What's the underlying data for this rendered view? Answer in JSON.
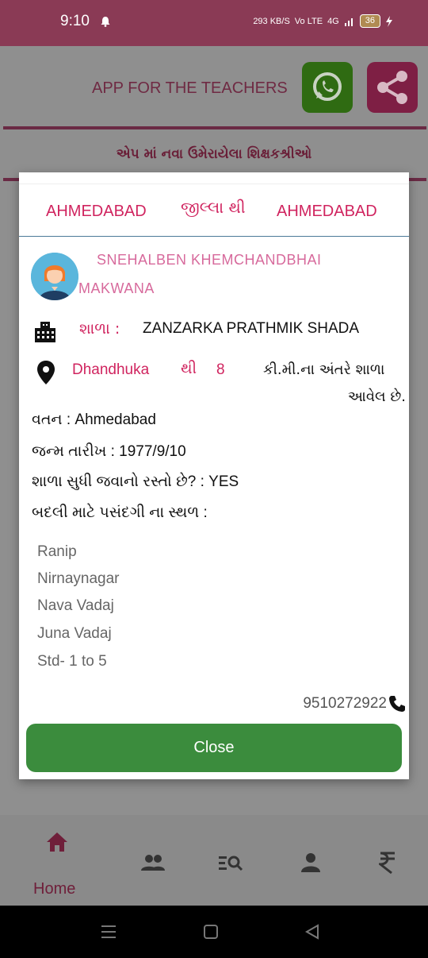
{
  "status_bar": {
    "time": "9:10",
    "net_speed": "293 KB/S",
    "carrier": "Vo LTE",
    "signal": "4G",
    "battery": "36"
  },
  "header": {
    "title": "APP FOR THE TEACHERS"
  },
  "banner": {
    "text": "એપ માં નવા ઉમેરાયેલા શિક્ષકશ્રીઓ"
  },
  "dialog": {
    "district_from": "AHMEDABAD",
    "district_mid": "જીલ્લા થી",
    "district_to": "AHMEDABAD",
    "name_line1": "SNEHALBEN KHEMCHANDBHAI",
    "name_line2": "MAKWANA",
    "school_label": "શાળા :",
    "school_name": "ZANZARKA PRATHMIK SHADA",
    "location_from": "Dhandhuka",
    "location_thi": "થી",
    "distance_km": "8",
    "distance_text1": "કી.મી.ના અંતરે શાળા",
    "distance_text2": "આવેલ છે.",
    "native": "વતન : Ahmedabad",
    "dob": "જન્મ તારીખ : 1977/9/10",
    "road": "શાળા સુધી જવાનો રસ્તો છે? : YES",
    "preference_label": "બદલી માટે પસંદગી ના સ્થળ :",
    "preferences": [
      "Ranip",
      "Nirnaynagar",
      "Nava Vadaj",
      "Juna Vadaj",
      "Std- 1 to 5"
    ],
    "phone": "9510272922",
    "close_label": "Close"
  },
  "bottom_nav": {
    "home_label": "Home"
  }
}
